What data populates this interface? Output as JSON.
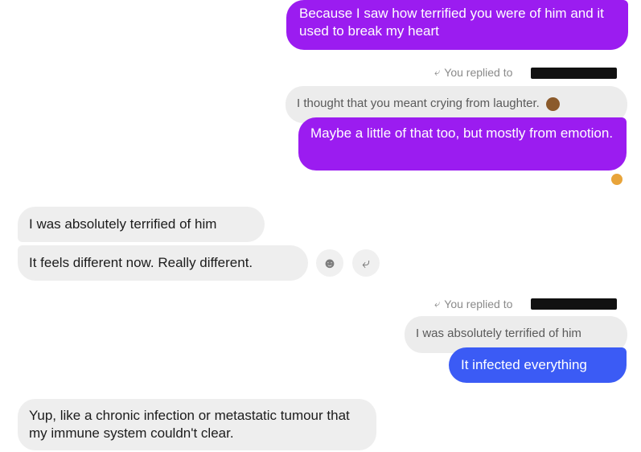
{
  "messages": {
    "m1": "Because I saw how terrified you were of him and it used to break my heart",
    "reply1_label": "You replied to",
    "quote1": "I thought that you meant crying from laughter.",
    "m2": "Maybe a little of that too, but mostly from emotion.",
    "in1": "I was absolutely terrified of him",
    "in2": "It feels different now. Really different.",
    "reply2_label": "You replied to",
    "quote2": "I was absolutely terrified of him",
    "m3": "It infected everything",
    "in3": "Yup, like a chronic infection or metastatic tumour that my immune system couldn't clear."
  },
  "icons": {
    "reply_arrow": "reply-arrow-icon",
    "react": "smiley-icon",
    "reply": "reply-icon",
    "see_no_evil": "see-no-evil-monkey-emoji",
    "reaction": "reaction-emoji"
  },
  "colors": {
    "outgoing_purple": "#9b1cf0",
    "outgoing_blue": "#3b5bf5",
    "incoming": "#eeeeee"
  }
}
